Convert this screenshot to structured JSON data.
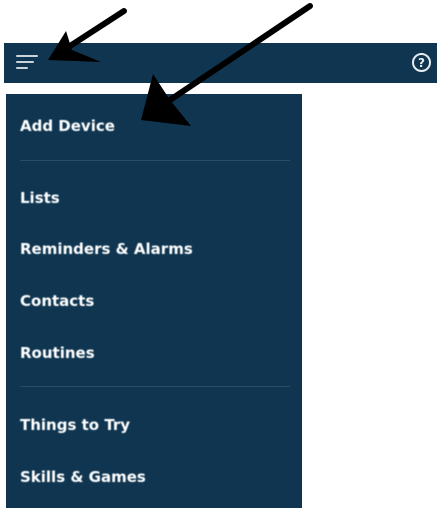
{
  "header": {
    "menu_icon": "hamburger-menu-icon",
    "help_icon": "help-question-icon",
    "help_glyph": "?"
  },
  "menu": {
    "sections": [
      {
        "items": [
          {
            "label": "Add Device"
          }
        ]
      },
      {
        "items": [
          {
            "label": "Lists"
          },
          {
            "label": "Reminders & Alarms"
          },
          {
            "label": "Contacts"
          },
          {
            "label": "Routines"
          }
        ]
      },
      {
        "items": [
          {
            "label": "Things to Try"
          },
          {
            "label": "Skills & Games"
          }
        ]
      }
    ]
  },
  "colors": {
    "nav_background": "#0f3550",
    "menu_text": "#ffffff",
    "icon_color": "#c9d3da",
    "arrow_color": "#000000"
  }
}
